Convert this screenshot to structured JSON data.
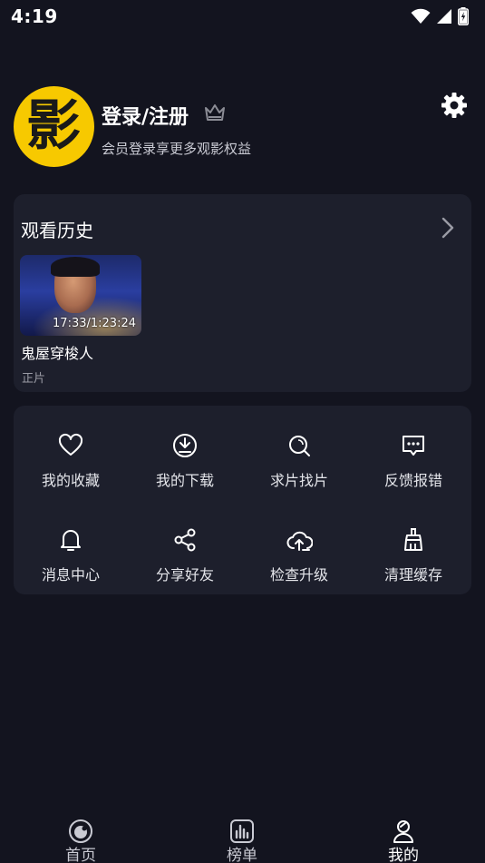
{
  "status_bar": {
    "time": "4:19",
    "icons": [
      "wifi-icon",
      "signal-icon",
      "battery-charging-icon"
    ]
  },
  "profile": {
    "avatar_char": "影",
    "login_label": "登录/注册",
    "subtitle": "会员登录享更多观影权益",
    "icons": [
      "crown-icon",
      "gear-icon"
    ]
  },
  "history": {
    "title": "观看历史",
    "items": [
      {
        "progress": "17:33/1:23:24",
        "title": "鬼屋穿梭人",
        "sub": "正片"
      }
    ]
  },
  "menu": {
    "items": [
      {
        "label": "我的收藏",
        "icon": "heart-icon"
      },
      {
        "label": "我的下载",
        "icon": "download-icon"
      },
      {
        "label": "求片找片",
        "icon": "search-icon"
      },
      {
        "label": "反馈报错",
        "icon": "feedback-icon"
      },
      {
        "label": "消息中心",
        "icon": "bell-icon"
      },
      {
        "label": "分享好友",
        "icon": "share-icon"
      },
      {
        "label": "检查升级",
        "icon": "cloud-upload-icon"
      },
      {
        "label": "清理缓存",
        "icon": "broom-icon"
      }
    ]
  },
  "nav": {
    "items": [
      {
        "label": "首页",
        "icon": "home-icon"
      },
      {
        "label": "榜单",
        "icon": "chart-icon"
      },
      {
        "label": "我的",
        "icon": "user-icon",
        "active": true
      }
    ]
  },
  "colors": {
    "background": "#13141f",
    "card": "#1d1f2c",
    "brand_yellow": "#f7c900"
  }
}
